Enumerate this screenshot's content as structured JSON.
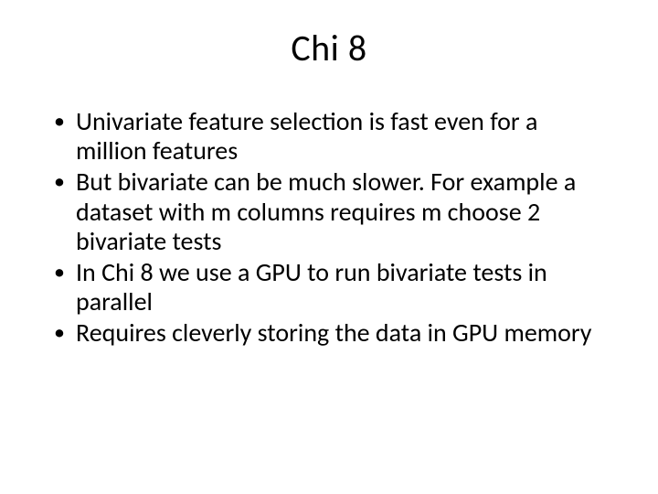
{
  "title": "Chi 8",
  "bullets": [
    "Univariate feature selection is fast even for a million features",
    "But bivariate can be much slower. For example a dataset with m columns requires m choose 2 bivariate tests",
    "In Chi 8 we use a GPU to run bivariate tests in parallel",
    "Requires cleverly storing the data in GPU memory"
  ]
}
